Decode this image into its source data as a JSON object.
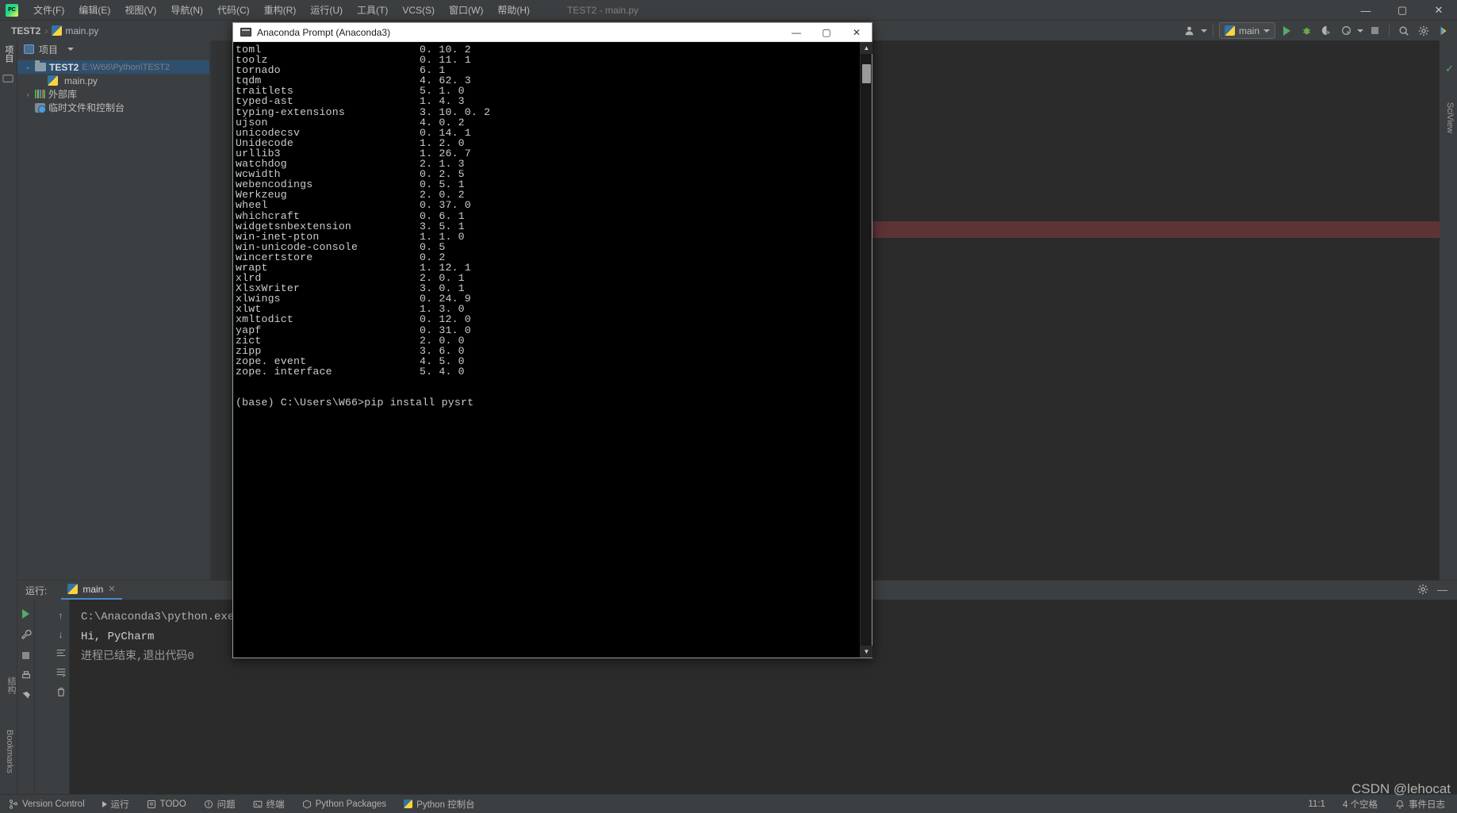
{
  "ide": {
    "menu": [
      "文件(F)",
      "编辑(E)",
      "视图(V)",
      "导航(N)",
      "代码(C)",
      "重构(R)",
      "运行(U)",
      "工具(T)",
      "VCS(S)",
      "窗口(W)",
      "帮助(H)"
    ],
    "window_title": "TEST2 - main.py",
    "window_controls": {
      "minimize": "—",
      "maximize": "▢",
      "close": "✕"
    },
    "breadcrumb": {
      "project": "TEST2",
      "separator": "›",
      "file": "main.py"
    },
    "toolbar": {
      "run_config": "main",
      "profile_caret": "▾"
    }
  },
  "left_strip": {
    "project_tab": "项目",
    "structure_tab": "结构",
    "bookmarks_tab": "Bookmarks"
  },
  "right_strip": {
    "sci_view": "SciView"
  },
  "project": {
    "header": "项目",
    "tree": [
      {
        "label": "TEST2",
        "path": "E:\\W66\\Python\\TEST2",
        "icon": "folder-icon",
        "selected": true,
        "arrow": "⌄"
      },
      {
        "label": "main.py",
        "path": "",
        "icon": "python-file-icon",
        "selected": false,
        "arrow": ""
      },
      {
        "label": "外部库",
        "path": "",
        "icon": "library-icon",
        "selected": false,
        "arrow": "›"
      },
      {
        "label": "临时文件和控制台",
        "path": "",
        "icon": "scratch-icon",
        "selected": false,
        "arrow": ""
      }
    ]
  },
  "run_panel": {
    "label": "运行:",
    "tab": "main",
    "tab_close": "✕",
    "console": [
      "C:\\Anaconda3\\python.exe",
      "",
      "Hi, PyCharm",
      "",
      "",
      "进程已结束,退出代码0"
    ]
  },
  "status_bar": {
    "left": [
      {
        "label": "Version Control",
        "icon": "branch-icon"
      },
      {
        "label": "运行",
        "icon": "play-icon"
      },
      {
        "label": "TODO",
        "icon": "todo-icon"
      },
      {
        "label": "问题",
        "icon": "problems-icon"
      },
      {
        "label": "终端",
        "icon": "terminal-icon"
      },
      {
        "label": "Python Packages",
        "icon": "packages-icon"
      },
      {
        "label": "Python 控制台",
        "icon": "python-console-icon"
      }
    ],
    "caret_position": "11:1",
    "indent": "4 个空格",
    "event_log": "事件日志",
    "watermark": "CSDN @lehocat"
  },
  "cmd_window": {
    "title": "Anaconda Prompt (Anaconda3)",
    "icon": "console-icon",
    "controls": {
      "minimize": "—",
      "maximize": "▢",
      "close": "✕"
    },
    "packages": [
      {
        "name": "toml",
        "version": "0. 10. 2"
      },
      {
        "name": "toolz",
        "version": "0. 11. 1"
      },
      {
        "name": "tornado",
        "version": "6. 1"
      },
      {
        "name": "tqdm",
        "version": "4. 62. 3"
      },
      {
        "name": "traitlets",
        "version": "5. 1. 0"
      },
      {
        "name": "typed-ast",
        "version": "1. 4. 3"
      },
      {
        "name": "typing-extensions",
        "version": "3. 10. 0. 2"
      },
      {
        "name": "ujson",
        "version": "4. 0. 2"
      },
      {
        "name": "unicodecsv",
        "version": "0. 14. 1"
      },
      {
        "name": "Unidecode",
        "version": "1. 2. 0"
      },
      {
        "name": "urllib3",
        "version": "1. 26. 7"
      },
      {
        "name": "watchdog",
        "version": "2. 1. 3"
      },
      {
        "name": "wcwidth",
        "version": "0. 2. 5"
      },
      {
        "name": "webencodings",
        "version": "0. 5. 1"
      },
      {
        "name": "Werkzeug",
        "version": "2. 0. 2"
      },
      {
        "name": "wheel",
        "version": "0. 37. 0"
      },
      {
        "name": "whichcraft",
        "version": "0. 6. 1"
      },
      {
        "name": "widgetsnbextension",
        "version": "3. 5. 1"
      },
      {
        "name": "win-inet-pton",
        "version": "1. 1. 0"
      },
      {
        "name": "win-unicode-console",
        "version": "0. 5"
      },
      {
        "name": "wincertstore",
        "version": "0. 2"
      },
      {
        "name": "wrapt",
        "version": "1. 12. 1"
      },
      {
        "name": "xlrd",
        "version": "2. 0. 1"
      },
      {
        "name": "XlsxWriter",
        "version": "3. 0. 1"
      },
      {
        "name": "xlwings",
        "version": "0. 24. 9"
      },
      {
        "name": "xlwt",
        "version": "1. 3. 0"
      },
      {
        "name": "xmltodict",
        "version": "0. 12. 0"
      },
      {
        "name": "yapf",
        "version": "0. 31. 0"
      },
      {
        "name": "zict",
        "version": "2. 0. 0"
      },
      {
        "name": "zipp",
        "version": "3. 6. 0"
      },
      {
        "name": "zope. event",
        "version": "4. 5. 0"
      },
      {
        "name": "zope. interface",
        "version": "5. 4. 0"
      }
    ],
    "prompt_line": "(base) C:\\Users\\W66>pip install pysrt",
    "scrollbar": {
      "up": "▲",
      "down": "▼"
    }
  }
}
